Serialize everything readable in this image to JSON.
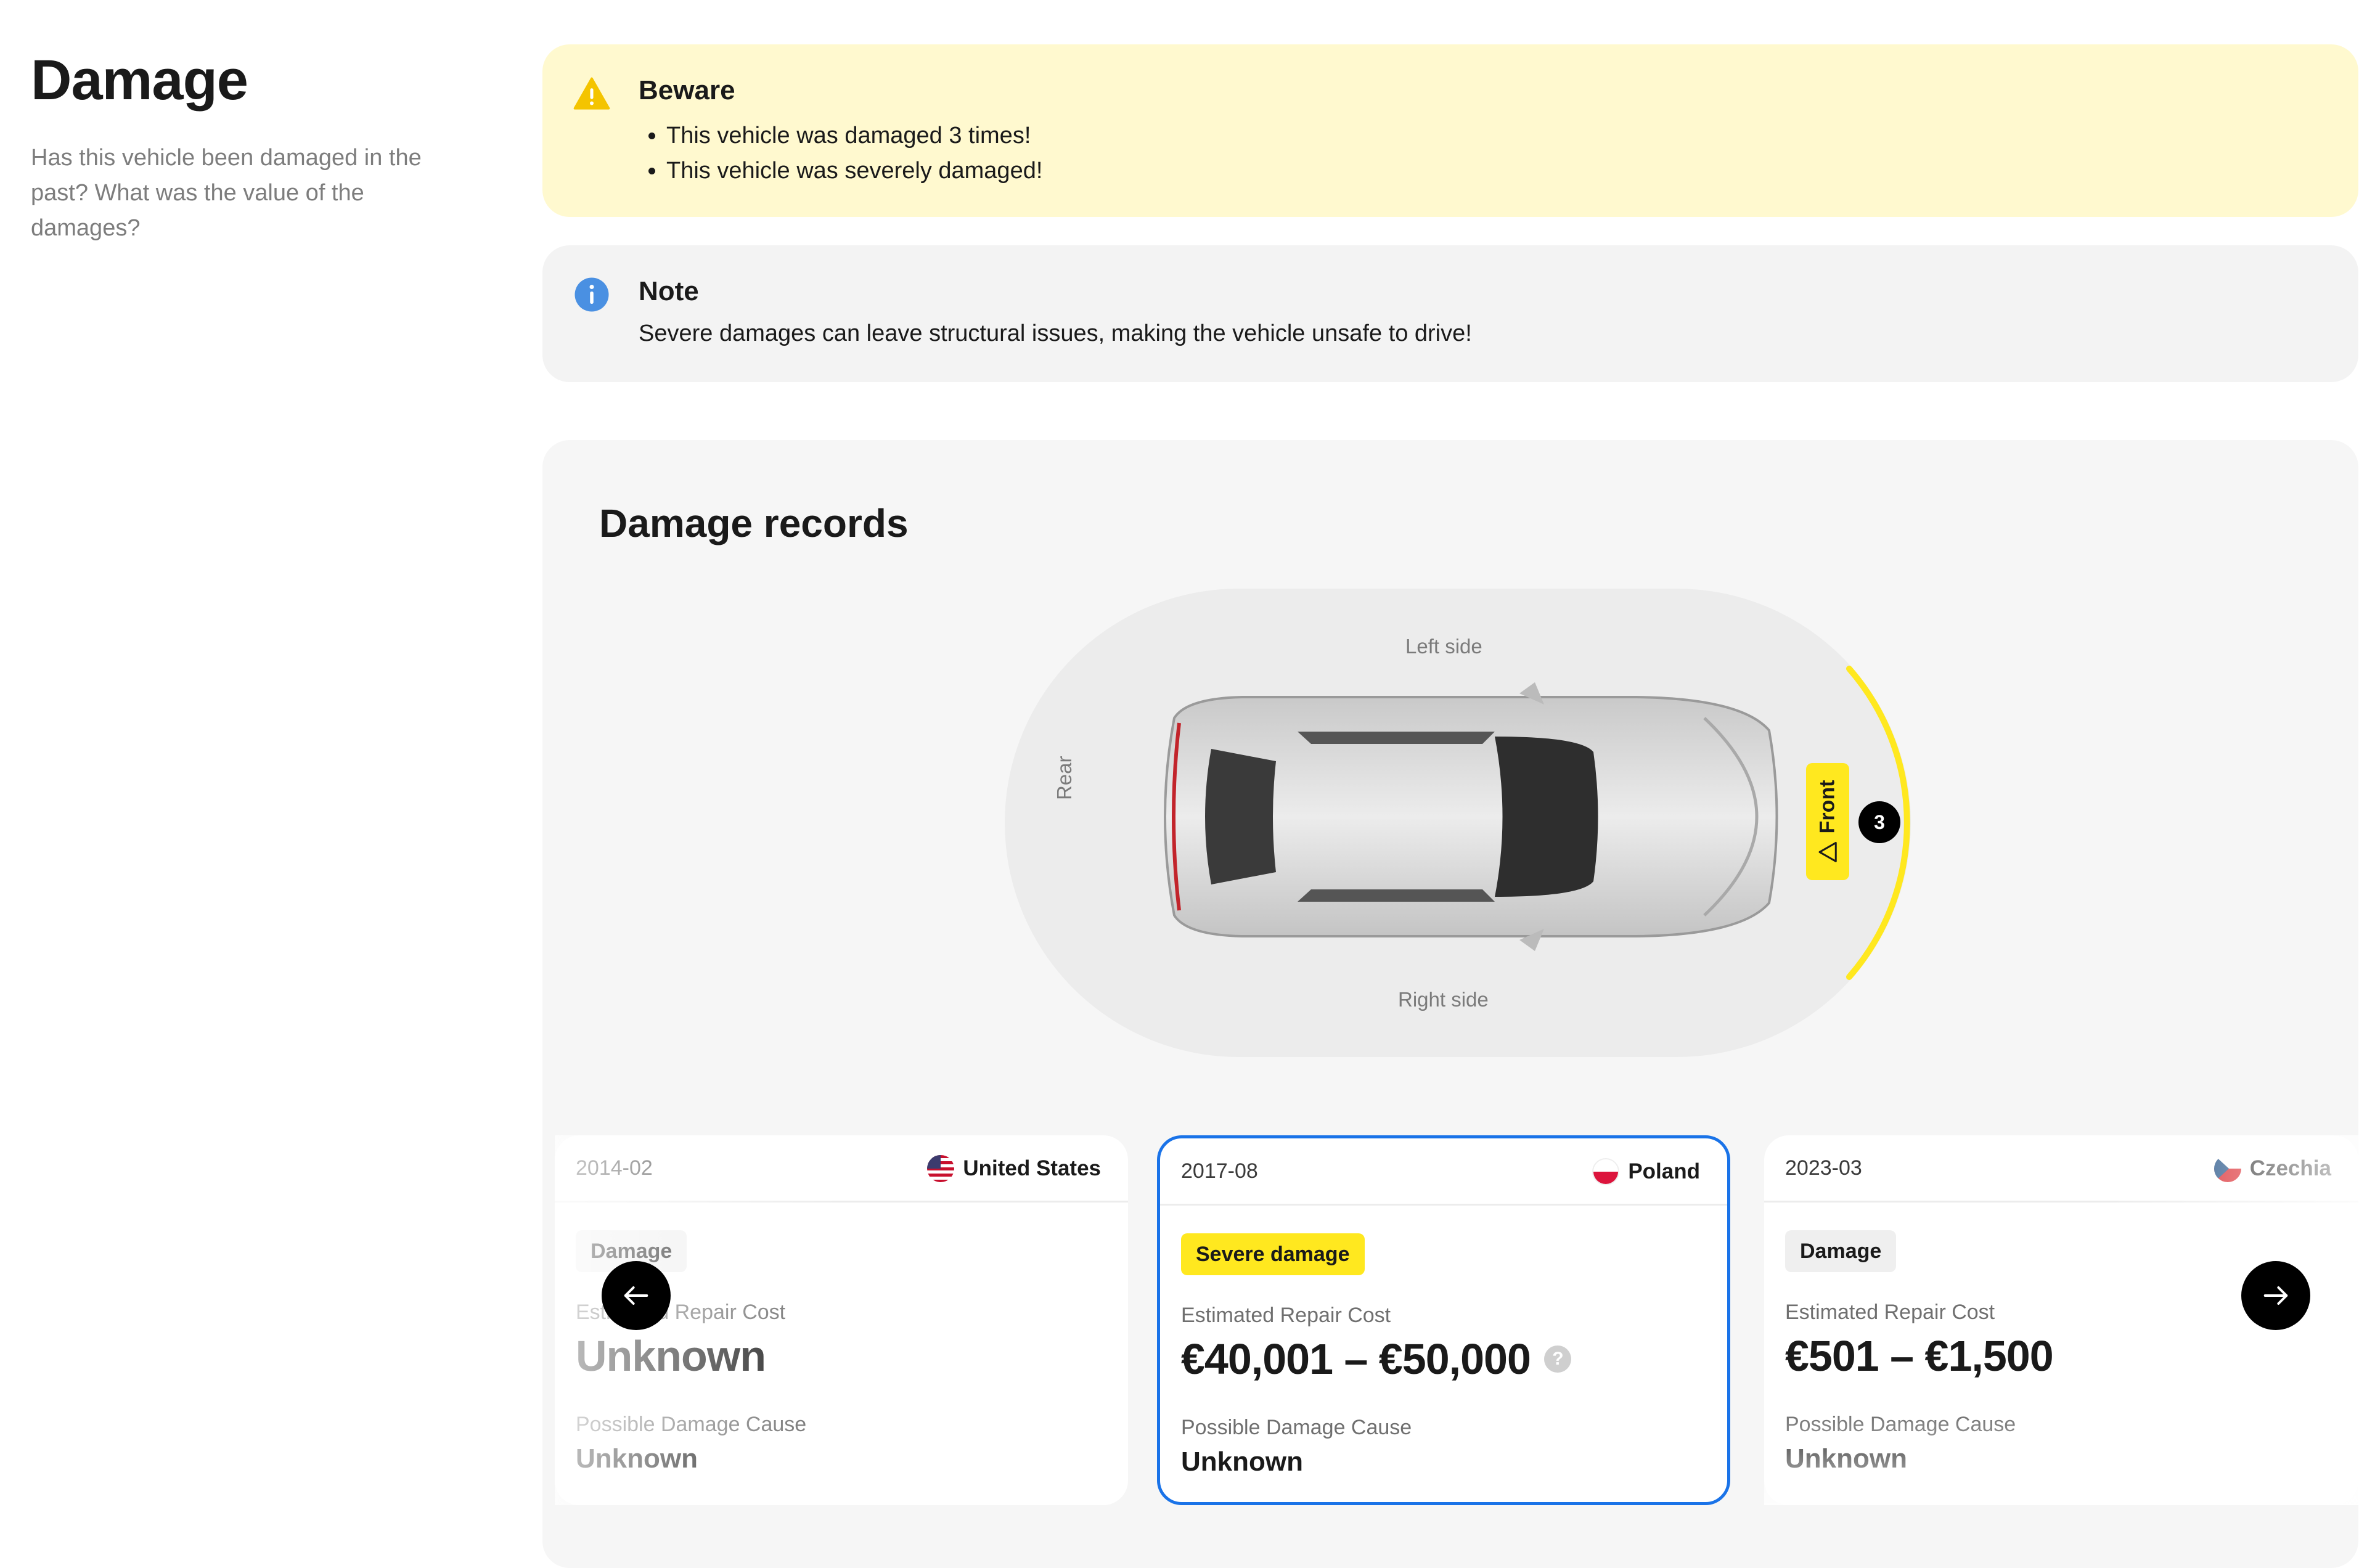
{
  "section": {
    "title": "Damage",
    "description": "Has this vehicle been damaged in the past? What was the value of the damages?"
  },
  "alerts": {
    "beware": {
      "title": "Beware",
      "items": [
        "This vehicle was damaged 3 times!",
        "This vehicle was severely damaged!"
      ],
      "color": "#fff9cf",
      "icon": "warning-icon"
    },
    "note": {
      "title": "Note",
      "text": "Severe damages can leave structural issues, making the vehicle unsafe to drive!",
      "color": "#f3f3f3",
      "icon": "info-icon"
    }
  },
  "records": {
    "title": "Damage records",
    "diagram": {
      "left_label": "Left side",
      "right_label": "Right side",
      "rear_label": "Rear",
      "front_label": "Front",
      "front_count": "3",
      "highlight_color": "#ffe81f"
    },
    "cards": [
      {
        "date": "2014-02",
        "country": "United States",
        "flag": "us-flag-icon",
        "badge": "Damage",
        "cost_label": "Estimated Repair Cost",
        "cost": "Unknown",
        "cause_label": "Possible Damage Cause",
        "cause": "Unknown"
      },
      {
        "date": "2017-08",
        "country": "Poland",
        "flag": "poland-flag-icon",
        "badge": "Severe damage",
        "cost_label": "Estimated Repair Cost",
        "cost": "€40,001 – €50,000",
        "cause_label": "Possible Damage Cause",
        "cause": "Unknown",
        "selected_border_color": "#1a73e8"
      },
      {
        "date": "2023-03",
        "country": "Czechia",
        "flag": "czechia-flag-icon",
        "badge": "Damage",
        "cost_label": "Estimated Repair Cost",
        "cost": "€501 – €1,500",
        "cause_label": "Possible Damage Cause",
        "cause": "Unknown"
      }
    ],
    "nav": {
      "prev_icon": "arrow-left-icon",
      "next_icon": "arrow-right-icon"
    }
  }
}
